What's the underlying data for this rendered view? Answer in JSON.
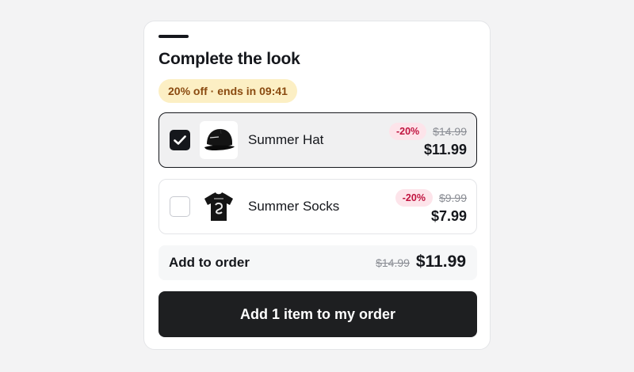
{
  "header": {
    "title": "Complete the look",
    "timer_badge": "20% off · ends in 09:41"
  },
  "items": [
    {
      "name": "Summer Hat",
      "selected": true,
      "discount": "-20%",
      "old_price": "$14.99",
      "new_price": "$11.99",
      "thumbnail_icon": "black-cap-image"
    },
    {
      "name": "Summer Socks",
      "selected": false,
      "discount": "-20%",
      "old_price": "$9.99",
      "new_price": "$7.99",
      "thumbnail_icon": "black-tshirt-image"
    }
  ],
  "summary": {
    "label": "Add to order",
    "old_total": "$14.99",
    "new_total": "$11.99"
  },
  "cta": {
    "label": "Add 1 item to my order"
  },
  "colors": {
    "accent": "#15171c",
    "timer_bg": "#fcefc4",
    "timer_text": "#8a4a10",
    "discount_bg": "#fde4ea",
    "discount_text": "#c0133f",
    "button_bg": "#1e1f21"
  }
}
